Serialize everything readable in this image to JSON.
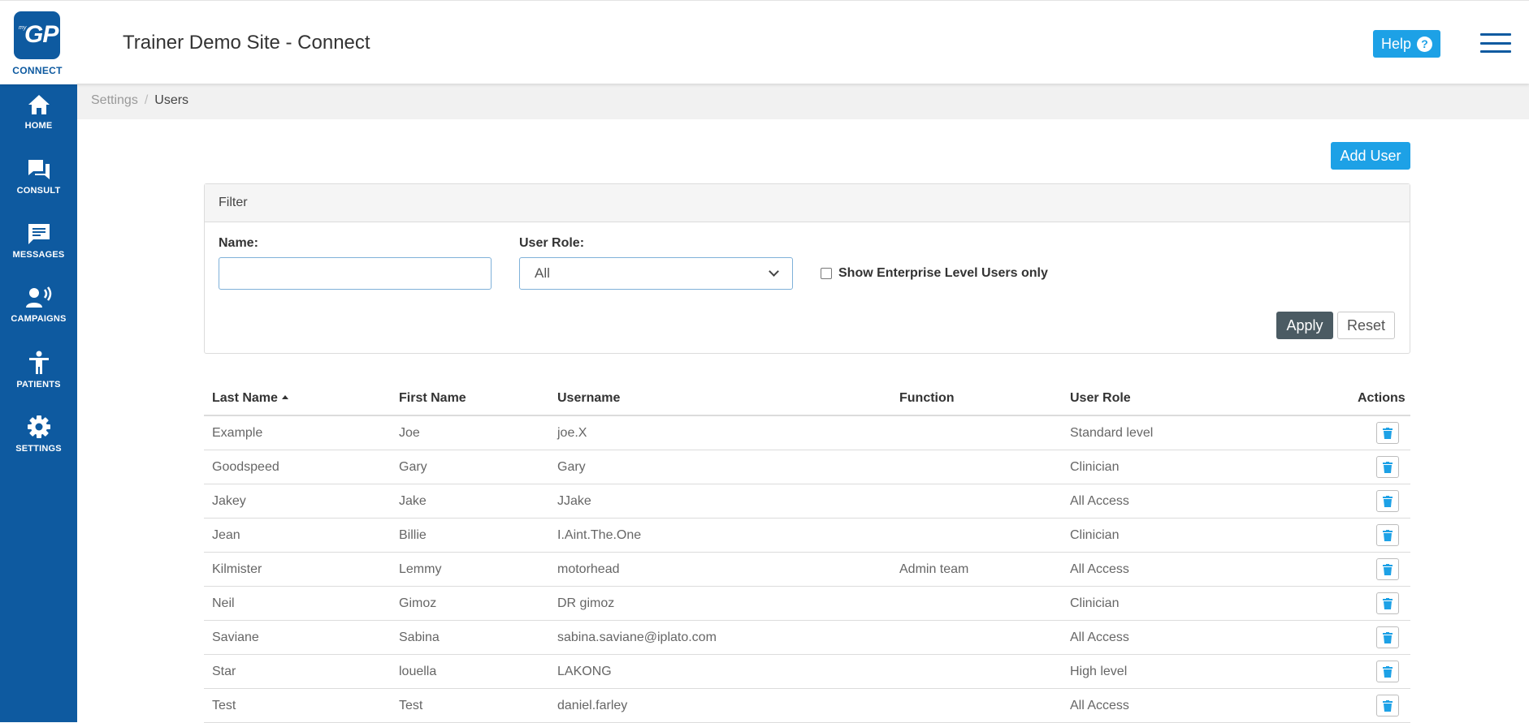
{
  "header": {
    "logo_my": "my",
    "logo_gp": "GP",
    "logo_connect": "CONNECT",
    "title": "Trainer Demo Site - Connect",
    "help_label": "Help",
    "help_q": "?"
  },
  "sidebar": {
    "items": [
      {
        "label": "HOME",
        "icon": "home-icon"
      },
      {
        "label": "CONSULT",
        "icon": "consult-icon"
      },
      {
        "label": "MESSAGES",
        "icon": "messages-icon"
      },
      {
        "label": "CAMPAIGNS",
        "icon": "campaigns-icon"
      },
      {
        "label": "PATIENTS",
        "icon": "patients-icon"
      },
      {
        "label": "SETTINGS",
        "icon": "gear-icon"
      }
    ]
  },
  "breadcrumb": {
    "parent": "Settings",
    "sep": "/",
    "current": "Users"
  },
  "actions": {
    "add_user": "Add User"
  },
  "filter": {
    "title": "Filter",
    "name_label": "Name:",
    "name_value": "",
    "role_label": "User Role:",
    "role_value": "All",
    "enterprise_label": "Show Enterprise Level Users only",
    "enterprise_checked": false,
    "apply": "Apply",
    "reset": "Reset"
  },
  "table": {
    "columns": [
      "Last Name",
      "First Name",
      "Username",
      "Function",
      "User Role",
      "Actions"
    ],
    "sorted_by": "Last Name",
    "rows": [
      {
        "last": "Example",
        "first": "Joe",
        "username": "joe.X",
        "function": "",
        "role": "Standard level"
      },
      {
        "last": "Goodspeed",
        "first": "Gary",
        "username": "Gary",
        "function": "",
        "role": "Clinician"
      },
      {
        "last": "Jakey",
        "first": "Jake",
        "username": "JJake",
        "function": "",
        "role": "All Access"
      },
      {
        "last": "Jean",
        "first": "Billie",
        "username": "I.Aint.The.One",
        "function": "",
        "role": "Clinician"
      },
      {
        "last": "Kilmister",
        "first": "Lemmy",
        "username": "motorhead",
        "function": "Admin team",
        "role": "All Access"
      },
      {
        "last": "Neil",
        "first": "Gimoz",
        "username": "DR gimoz",
        "function": "",
        "role": "Clinician"
      },
      {
        "last": "Saviane",
        "first": "Sabina",
        "username": "sabina.saviane@iplato.com",
        "function": "",
        "role": "All Access"
      },
      {
        "last": "Star",
        "first": "louella",
        "username": "LAKONG",
        "function": "",
        "role": "High level"
      },
      {
        "last": "Test",
        "first": "Test",
        "username": "daniel.farley",
        "function": "",
        "role": "All Access"
      }
    ]
  },
  "colors": {
    "brand": "#0e5aa0",
    "accent": "#1da1e6",
    "apply": "#4b5b63"
  }
}
